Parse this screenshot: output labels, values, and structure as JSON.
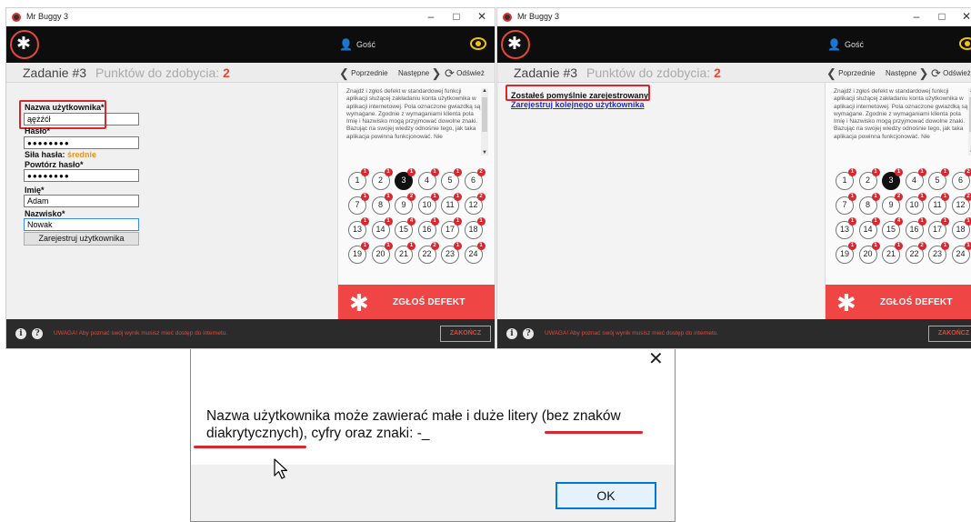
{
  "left_window": {
    "title": "Mr Buggy 3",
    "window_controls": {
      "minimize": "–",
      "maximize": "□",
      "close": "✕"
    },
    "user": "Gość",
    "task_title": "Zadanie #3",
    "points_label": "Punktów do zdobycia:",
    "points_value": "2",
    "nav": {
      "prev": "Poprzednie",
      "next": "Następne",
      "refresh": "Odśwież"
    },
    "form": {
      "username_label": "Nazwa użytkownika*",
      "username_value": "ąężźćł",
      "password_label": "Hasło*",
      "password_value": "●●●●●●●●",
      "strength_label": "Siła hasła:",
      "strength_value": "średnie",
      "repeat_label": "Powtórz hasło*",
      "repeat_value": "●●●●●●●●",
      "firstname_label": "Imię*",
      "firstname_value": "Adam",
      "lastname_label": "Nazwisko*",
      "lastname_value": "Nowak",
      "register_button": "Zarejestruj użytkownika"
    },
    "description": "Znajdź i zgłoś defekt w standardowej funkcji aplikacji służącej zakładaniu konta użytkownika w aplikacji internetowej. Pola oznaczone gwiazdką są wymagane. Zgodnie z wymaganiami klienta pola Imię i Nazwisko mogą przyjmować dowolne znaki. Bazując na swojej wiedzy odnośnie tego, jak taka aplikacja powinna funkcjonować. Nie",
    "report_defect": "ZGŁOŚ DEFEKT",
    "footer_warning": "UWAGA! Aby poznać swój wynik musisz mieć dostęp do internetu.",
    "end_button": "ZAKOŃCZ",
    "info_icon_glyph": "i",
    "help_icon_glyph": "?"
  },
  "right_window": {
    "title": "Mr Buggy 3",
    "window_controls": {
      "minimize": "–",
      "maximize": "□",
      "close": "✕"
    },
    "user": "Gość",
    "task_title": "Zadanie #3",
    "points_label": "Punktów do zdobycia:",
    "points_value": "2",
    "nav": {
      "prev": "Poprzednie",
      "next": "Następne",
      "refresh": "Odśwież"
    },
    "success_message": "Zostałeś pomyślnie zarejestrowany.",
    "register_another_link": "Zarejestruj kolejnego użytkownika",
    "description": "Znajdź i zgłoś defekt w standardowej funkcji aplikacji służącej zakładaniu konta użytkownika w aplikacji internetowej. Pola oznaczone gwiazdką są wymagane. Zgodnie z wymaganiami klienta pola Imię i Nazwisko mogą przyjmować dowolne znaki. Bazując na swojej wiedzy odnośnie tego, jak taka aplikacja powinna funkcjonować. Nie",
    "report_defect": "ZGŁOŚ DEFEKT",
    "footer_warning": "UWAGA! Aby poznać swój wynik musisz mieć dostęp do internetu.",
    "end_button": "ZAKOŃCZ",
    "info_icon_glyph": "i",
    "help_icon_glyph": "?"
  },
  "task_grid": {
    "numbers": [
      "1",
      "2",
      "3",
      "4",
      "5",
      "6",
      "7",
      "8",
      "9",
      "10",
      "11",
      "12",
      "13",
      "14",
      "15",
      "16",
      "17",
      "18",
      "19",
      "20",
      "21",
      "22",
      "23",
      "24"
    ],
    "badges": [
      "1",
      "1",
      "1",
      "1",
      "1",
      "2",
      "1",
      "1",
      "2",
      "1",
      "1",
      "2",
      "1",
      "1",
      "4",
      "1",
      "1",
      "1",
      "1",
      "1",
      "1",
      "2",
      "1",
      "1"
    ],
    "active_index": 2
  },
  "dialog": {
    "close_glyph": "✕",
    "message": "Nazwa użytkownika może zawierać małe i duże litery (bez znaków diakrytycznych), cyfry oraz znaki: -_",
    "ok_button": "OK"
  },
  "icons": [
    "bug-logo-icon",
    "user-icon",
    "eye-icon",
    "chevron-left-icon",
    "chevron-right-icon",
    "refresh-icon",
    "info-icon",
    "help-icon",
    "bug-icon",
    "close-icon",
    "mouse-cursor-icon"
  ],
  "colors": {
    "accent_red": "#ef4545",
    "topbar": "#0d0d0d",
    "footer": "#2b2b2b",
    "strength_orange": "#e8941a",
    "highlight_red": "#d8272e",
    "link_blue": "#1a2bd0",
    "ok_border": "#0078d7"
  }
}
